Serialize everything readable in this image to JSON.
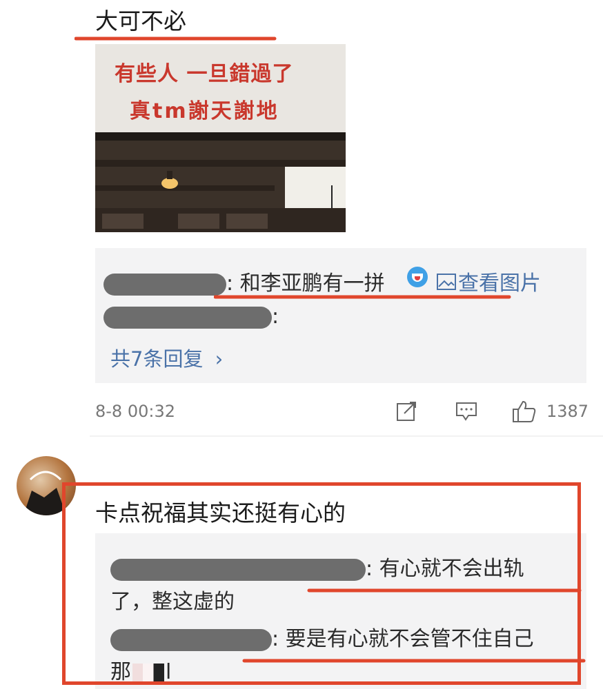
{
  "comment1": {
    "text": "大可不必",
    "image_caption_line1": "有些人  一旦錯過了",
    "image_caption_line2": "真tm謝天謝地"
  },
  "reply_box1": {
    "reply1_text": ": 和李亚鹏有一拼",
    "view_image_label": "查看图片",
    "reply2_text": ":",
    "more_replies": "共7条回复",
    "more_chevron": "›"
  },
  "meta1": {
    "time": "8-8 00:32",
    "like_count": "1387"
  },
  "comment2": {
    "text": "卡点祝福其实还挺有心的"
  },
  "reply_box2": {
    "reply1_text_line1": ": 有心就不会出轨",
    "reply1_text_line2": "了，整这虚的",
    "reply2_text_line1": ": 要是有心就不会管不住自己",
    "reply2_text_line2_a": "那",
    "reply2_text_line2_b": "l"
  },
  "colors": {
    "annotation_red": "#e0462c",
    "link_blue": "#4a72a8",
    "reply_bg": "#f3f3f4"
  }
}
